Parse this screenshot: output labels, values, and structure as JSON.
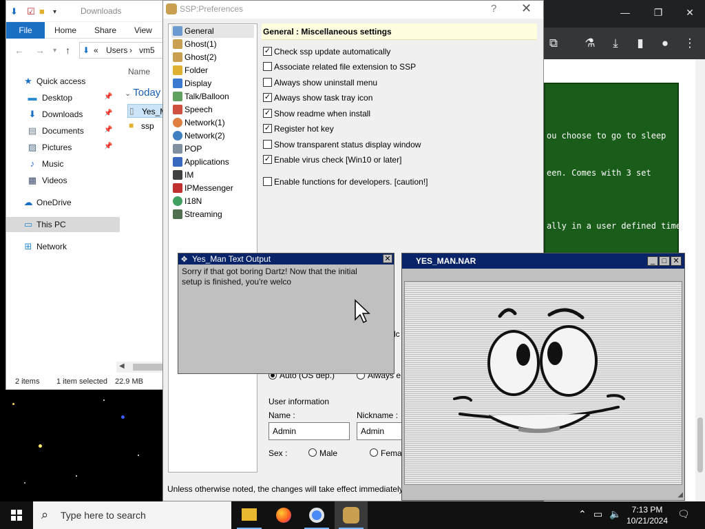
{
  "explorer": {
    "title": "Downloads",
    "ribbon": {
      "file": "File",
      "home": "Home",
      "share": "Share",
      "view": "View"
    },
    "address": {
      "part1": "Users",
      "part2": "vm5"
    },
    "nav": [
      {
        "label": "Quick access",
        "icon": "star-icon"
      },
      {
        "label": "Desktop",
        "icon": "desktop-icon"
      },
      {
        "label": "Downloads",
        "icon": "download-icon"
      },
      {
        "label": "Documents",
        "icon": "document-icon"
      },
      {
        "label": "Pictures",
        "icon": "pictures-icon"
      },
      {
        "label": "Music",
        "icon": "music-icon"
      },
      {
        "label": "Videos",
        "icon": "videos-icon"
      },
      {
        "label": "OneDrive",
        "icon": "cloud-icon"
      },
      {
        "label": "This PC",
        "icon": "computer-icon"
      },
      {
        "label": "Network",
        "icon": "network-icon"
      }
    ],
    "column_name": "Name",
    "group": "Today (",
    "files": [
      "Yes_M",
      "ssp"
    ],
    "status": {
      "count": "2 items",
      "selected": "1 item selected",
      "size": "22.9 MB"
    }
  },
  "ssp": {
    "title": "SSP:Preferences",
    "help": "?",
    "close": "✕",
    "tree": [
      {
        "label": "General",
        "color": "#6a9ad0"
      },
      {
        "label": "Ghost(1)",
        "color": "#c9a050"
      },
      {
        "label": "Ghost(2)",
        "color": "#c9a050"
      },
      {
        "label": "Folder",
        "color": "#e0b030"
      },
      {
        "label": "Display",
        "color": "#3a7ad0"
      },
      {
        "label": "Talk/Balloon",
        "color": "#60a060"
      },
      {
        "label": "Speech",
        "color": "#d05040"
      },
      {
        "label": "Network(1)",
        "color": "#e08040"
      },
      {
        "label": "Network(2)",
        "color": "#4080c0"
      },
      {
        "label": "POP",
        "color": "#8090a0"
      },
      {
        "label": "Applications",
        "color": "#3a6ac0"
      },
      {
        "label": "IM",
        "color": "#404040"
      },
      {
        "label": "IPMessenger",
        "color": "#c03030"
      },
      {
        "label": "I18N",
        "color": "#40a060"
      },
      {
        "label": "Streaming",
        "color": "#507050"
      }
    ],
    "panel_title": "General : Miscellaneous settings",
    "options": [
      {
        "label": "Check ssp update automatically",
        "checked": "✓"
      },
      {
        "label": "Associate related file extension to SSP",
        "checked": ""
      },
      {
        "label": "Always show uninstall menu",
        "checked": ""
      },
      {
        "label": "Always show task tray icon",
        "checked": "✓"
      },
      {
        "label": "Show readme when install",
        "checked": "✓"
      },
      {
        "label": "Register hot key",
        "checked": "✓"
      },
      {
        "label": "Show transparent status display window",
        "checked": ""
      },
      {
        "label": "Enable virus check [Win10 or later]",
        "checked": "✓"
      },
      {
        "label": "Enable functions for developers. [caution!]",
        "checked": ""
      }
    ],
    "partial_lc": "lc",
    "radio_auto": "Auto (OS dep.)",
    "radio_always": "Always e",
    "user_info": "User information",
    "name_label": "Name :",
    "name_value": "Admin",
    "nickname_label": "Nickname :",
    "nickname_value": "Admin",
    "sex_label": "Sex :",
    "male": "Male",
    "female": "Fema",
    "footer": "Unless otherwise noted, the changes will take effect immediately"
  },
  "textout": {
    "title": "Yes_Man Text Output",
    "line1": "Sorry if that got boring Dartz! Now that the initial",
    "line2": "setup is finished, you're welco"
  },
  "nar": {
    "title": "YES_MAN.NAR"
  },
  "browser": {
    "lines": [
      "ou choose to go to sleep",
      "een. Comes with 3 set",
      "ally in a user defined time"
    ]
  },
  "taskbar": {
    "search_placeholder": "Type here to search",
    "time": "7:13 PM",
    "date": "10/21/2024"
  }
}
